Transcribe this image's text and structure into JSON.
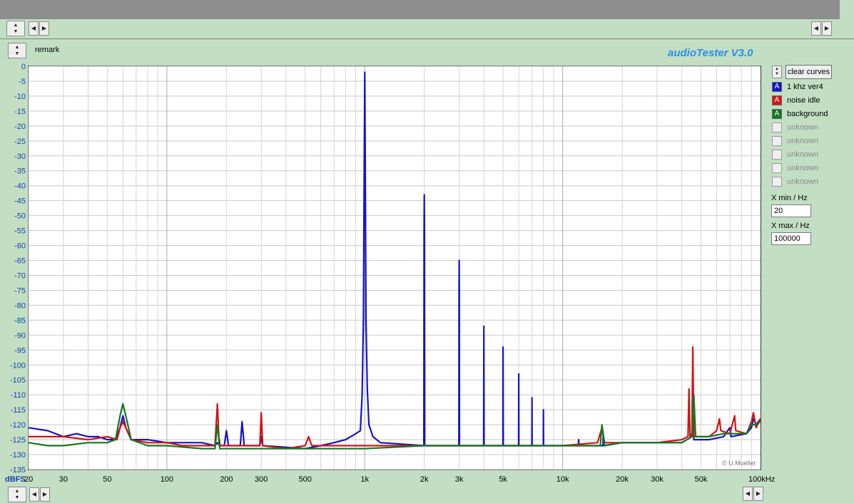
{
  "header": {
    "remark_label": "remark",
    "app_title": "audioTester  V3.0",
    "copyright": "© U.Mueller"
  },
  "controls": {
    "clear_curves_label": "clear curves",
    "xmin_label": "X min / Hz",
    "xmin_value": "20",
    "xmax_label": "X max / Hz",
    "xmax_value": "100000"
  },
  "legend": [
    {
      "label": "1 khz ver4",
      "color": "#1414c8",
      "glyph": "A",
      "active": true
    },
    {
      "label": "noise idle",
      "color": "#d21414",
      "glyph": "A",
      "active": true
    },
    {
      "label": "background",
      "color": "#12781e",
      "glyph": "A",
      "active": true
    },
    {
      "label": "unknown",
      "color": "#9a9a9a",
      "glyph": "",
      "active": false
    },
    {
      "label": "unknown",
      "color": "#9a9a9a",
      "glyph": "",
      "active": false
    },
    {
      "label": "unknown",
      "color": "#9a9a9a",
      "glyph": "",
      "active": false
    },
    {
      "label": "unknown",
      "color": "#9a9a9a",
      "glyph": "",
      "active": false
    },
    {
      "label": "unknown",
      "color": "#9a9a9a",
      "glyph": "",
      "active": false
    }
  ],
  "chart_data": {
    "type": "line",
    "xscale": "log",
    "xlim": [
      20,
      100000
    ],
    "ylim": [
      -135,
      0
    ],
    "ylabel": "dBFS",
    "xunit": "Hz",
    "grid": true,
    "y_ticks": [
      "0",
      "-5",
      "-10",
      "-15",
      "-20",
      "-25",
      "-30",
      "-35",
      "-40",
      "-45",
      "-50",
      "-55",
      "-60",
      "-65",
      "-70",
      "-75",
      "-80",
      "-85",
      "-90",
      "-95",
      "-100",
      "-105",
      "-110",
      "-115",
      "-120",
      "-125",
      "-130",
      "-135"
    ],
    "x_ticks": [
      {
        "v": 20,
        "label": "20"
      },
      {
        "v": 30,
        "label": "30"
      },
      {
        "v": 50,
        "label": "50"
      },
      {
        "v": 100,
        "label": "100"
      },
      {
        "v": 200,
        "label": "200"
      },
      {
        "v": 300,
        "label": "300"
      },
      {
        "v": 500,
        "label": "500"
      },
      {
        "v": 1000,
        "label": "1k"
      },
      {
        "v": 2000,
        "label": "2k"
      },
      {
        "v": 3000,
        "label": "3k"
      },
      {
        "v": 5000,
        "label": "5k"
      },
      {
        "v": 10000,
        "label": "10k"
      },
      {
        "v": 20000,
        "label": "20k"
      },
      {
        "v": 30000,
        "label": "30k"
      },
      {
        "v": 50000,
        "label": "50k"
      },
      {
        "v": 100000,
        "label": "100kHz"
      }
    ],
    "series": [
      {
        "name": "1 khz ver4",
        "color": "#1414c8",
        "points": [
          [
            20,
            -121
          ],
          [
            25,
            -122
          ],
          [
            30,
            -124
          ],
          [
            35,
            -123
          ],
          [
            40,
            -124
          ],
          [
            45,
            -124
          ],
          [
            50,
            -125
          ],
          [
            55,
            -125
          ],
          [
            58,
            -121
          ],
          [
            60,
            -117
          ],
          [
            62,
            -121
          ],
          [
            66,
            -125
          ],
          [
            80,
            -125
          ],
          [
            100,
            -126
          ],
          [
            120,
            -126
          ],
          [
            150,
            -126
          ],
          [
            175,
            -127
          ],
          [
            180,
            -126
          ],
          [
            185,
            -127
          ],
          [
            195,
            -127
          ],
          [
            200,
            -122
          ],
          [
            205,
            -127
          ],
          [
            235,
            -127
          ],
          [
            240,
            -119
          ],
          [
            246,
            -127
          ],
          [
            295,
            -127
          ],
          [
            300,
            -124
          ],
          [
            305,
            -127
          ],
          [
            500,
            -128
          ],
          [
            600,
            -127
          ],
          [
            700,
            -126
          ],
          [
            800,
            -125
          ],
          [
            900,
            -123
          ],
          [
            950,
            -122
          ],
          [
            970,
            -110
          ],
          [
            985,
            -84
          ],
          [
            995,
            -30
          ],
          [
            1000,
            -2
          ],
          [
            1005,
            -30
          ],
          [
            1015,
            -85
          ],
          [
            1030,
            -108
          ],
          [
            1050,
            -120
          ],
          [
            1100,
            -124
          ],
          [
            1200,
            -126
          ],
          [
            1990,
            -127
          ],
          [
            1995,
            -55
          ],
          [
            2000,
            -43
          ],
          [
            2005,
            -55
          ],
          [
            2010,
            -127
          ],
          [
            2990,
            -127
          ],
          [
            2995,
            -75
          ],
          [
            3000,
            -65
          ],
          [
            3005,
            -75
          ],
          [
            3010,
            -127
          ],
          [
            3990,
            -127
          ],
          [
            4000,
            -87
          ],
          [
            4010,
            -127
          ],
          [
            4990,
            -127
          ],
          [
            5000,
            -94
          ],
          [
            5010,
            -127
          ],
          [
            5990,
            -127
          ],
          [
            6000,
            -103
          ],
          [
            6010,
            -127
          ],
          [
            6990,
            -127
          ],
          [
            7000,
            -111
          ],
          [
            7010,
            -127
          ],
          [
            7990,
            -127
          ],
          [
            8000,
            -115
          ],
          [
            8010,
            -127
          ],
          [
            12000,
            -127
          ],
          [
            12050,
            -125
          ],
          [
            12100,
            -127
          ],
          [
            16000,
            -127
          ],
          [
            16050,
            -123
          ],
          [
            16100,
            -127
          ],
          [
            20000,
            -126
          ],
          [
            30000,
            -126
          ],
          [
            40000,
            -126
          ],
          [
            45000,
            -124
          ],
          [
            45500,
            -120
          ],
          [
            46000,
            -125
          ],
          [
            55000,
            -125
          ],
          [
            65000,
            -124
          ],
          [
            70000,
            -121
          ],
          [
            71000,
            -124
          ],
          [
            85000,
            -123
          ],
          [
            90000,
            -121
          ],
          [
            92000,
            -118
          ],
          [
            95000,
            -120
          ],
          [
            100000,
            -118
          ]
        ]
      },
      {
        "name": "noise idle",
        "color": "#d21414",
        "points": [
          [
            20,
            -124
          ],
          [
            30,
            -124
          ],
          [
            40,
            -125
          ],
          [
            50,
            -124
          ],
          [
            56,
            -125
          ],
          [
            58,
            -121
          ],
          [
            60,
            -119
          ],
          [
            62,
            -121
          ],
          [
            66,
            -125
          ],
          [
            80,
            -126
          ],
          [
            100,
            -126
          ],
          [
            120,
            -127
          ],
          [
            150,
            -127
          ],
          [
            175,
            -127
          ],
          [
            180,
            -113
          ],
          [
            183,
            -124
          ],
          [
            186,
            -127
          ],
          [
            295,
            -127
          ],
          [
            300,
            -116
          ],
          [
            305,
            -127
          ],
          [
            400,
            -128
          ],
          [
            500,
            -127
          ],
          [
            520,
            -124
          ],
          [
            540,
            -127
          ],
          [
            1000,
            -127
          ],
          [
            2000,
            -127
          ],
          [
            5000,
            -127
          ],
          [
            10000,
            -127
          ],
          [
            15000,
            -126
          ],
          [
            15800,
            -121
          ],
          [
            16300,
            -126
          ],
          [
            20000,
            -126
          ],
          [
            30000,
            -126
          ],
          [
            40000,
            -125
          ],
          [
            43000,
            -124
          ],
          [
            43500,
            -108
          ],
          [
            44000,
            -124
          ],
          [
            45000,
            -123
          ],
          [
            45500,
            -94
          ],
          [
            46000,
            -124
          ],
          [
            55000,
            -124
          ],
          [
            60000,
            -122
          ],
          [
            62000,
            -118
          ],
          [
            63000,
            -122
          ],
          [
            70000,
            -123
          ],
          [
            74000,
            -117
          ],
          [
            75000,
            -122
          ],
          [
            85000,
            -123
          ],
          [
            90000,
            -119
          ],
          [
            92000,
            -116
          ],
          [
            95000,
            -121
          ],
          [
            100000,
            -118
          ]
        ]
      },
      {
        "name": "background",
        "color": "#12781e",
        "points": [
          [
            20,
            -126
          ],
          [
            25,
            -127
          ],
          [
            30,
            -127
          ],
          [
            40,
            -126
          ],
          [
            50,
            -126
          ],
          [
            55,
            -125
          ],
          [
            58,
            -117
          ],
          [
            60,
            -113
          ],
          [
            62,
            -117
          ],
          [
            66,
            -125
          ],
          [
            80,
            -127
          ],
          [
            100,
            -127
          ],
          [
            150,
            -128
          ],
          [
            175,
            -128
          ],
          [
            180,
            -120
          ],
          [
            185,
            -128
          ],
          [
            200,
            -128
          ],
          [
            300,
            -128
          ],
          [
            500,
            -128
          ],
          [
            1000,
            -128
          ],
          [
            2000,
            -127
          ],
          [
            5000,
            -127
          ],
          [
            10000,
            -127
          ],
          [
            15500,
            -127
          ],
          [
            15800,
            -120
          ],
          [
            16300,
            -127
          ],
          [
            20000,
            -126
          ],
          [
            30000,
            -126
          ],
          [
            40000,
            -126
          ],
          [
            45000,
            -124
          ],
          [
            46000,
            -110
          ],
          [
            47000,
            -124
          ],
          [
            55000,
            -124
          ],
          [
            65000,
            -123
          ],
          [
            75000,
            -123
          ],
          [
            85000,
            -123
          ],
          [
            90000,
            -120
          ],
          [
            95000,
            -120
          ],
          [
            100000,
            -119
          ]
        ]
      }
    ]
  }
}
